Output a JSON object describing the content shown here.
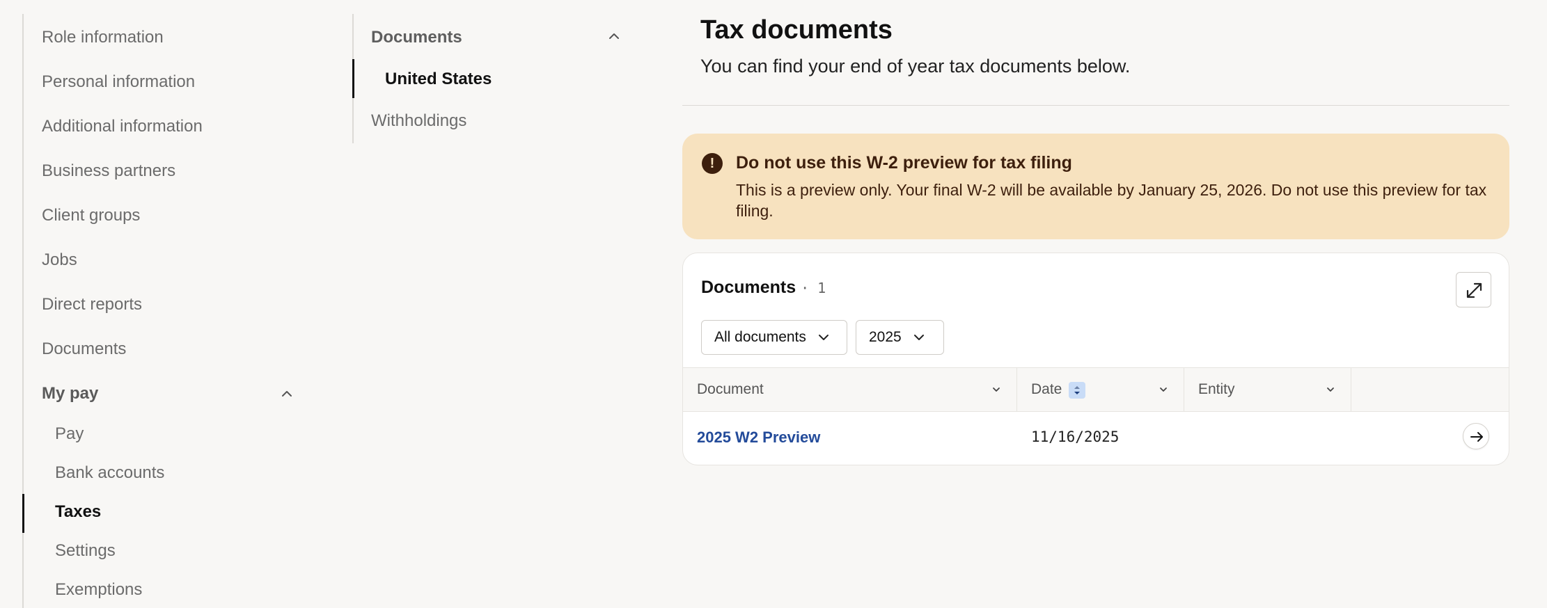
{
  "left_nav": {
    "items": [
      {
        "label": "Role information"
      },
      {
        "label": "Personal information"
      },
      {
        "label": "Additional information"
      },
      {
        "label": "Business partners"
      },
      {
        "label": "Client groups"
      },
      {
        "label": "Jobs"
      },
      {
        "label": "Direct reports"
      },
      {
        "label": "Documents"
      }
    ],
    "group": {
      "label": "My pay",
      "children": [
        {
          "label": "Pay"
        },
        {
          "label": "Bank accounts"
        },
        {
          "label": "Taxes",
          "active": true
        },
        {
          "label": "Settings"
        },
        {
          "label": "Exemptions"
        }
      ]
    }
  },
  "mid_nav": {
    "section": "Documents",
    "items": [
      {
        "label": "United States",
        "active": true
      },
      {
        "label": "Withholdings"
      }
    ]
  },
  "main": {
    "title": "Tax documents",
    "subtitle": "You can find your end of year tax documents below.",
    "banner": {
      "icon": "alert-icon",
      "icon_glyph": "!",
      "title": "Do not use this W-2 preview for tax filing",
      "body": "This is a preview only. Your final W-2 will be available by January 25, 2026. Do not use this preview for tax filing."
    },
    "documents_card": {
      "title": "Documents",
      "count": "· 1",
      "filters": [
        {
          "label": "All documents"
        },
        {
          "label": "2025"
        }
      ],
      "columns": [
        "Document",
        "Date",
        "Entity"
      ],
      "rows": [
        {
          "document": "2025 W2 Preview",
          "date": "11/16/2025",
          "entity": ""
        }
      ]
    }
  },
  "colors": {
    "banner_bg": "#f7e2bf",
    "banner_text": "#3d1f0d",
    "link": "#234b9a",
    "sort_badge": "#c9dcf7"
  }
}
